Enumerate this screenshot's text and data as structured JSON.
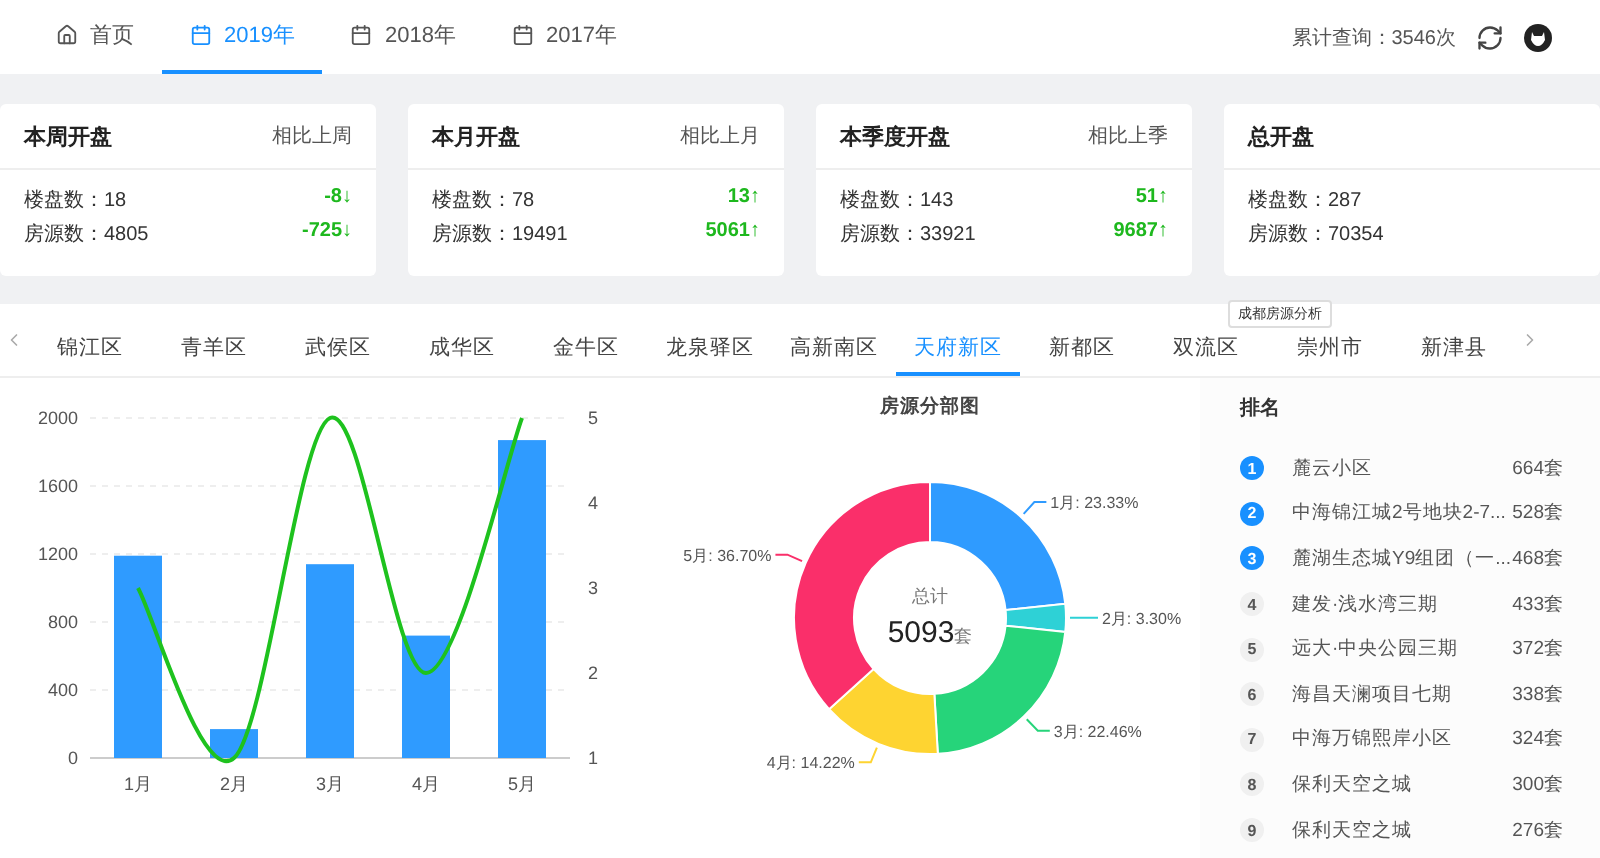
{
  "nav": {
    "items": [
      {
        "label": "首页",
        "selected": false
      },
      {
        "label": "2019年",
        "selected": true
      },
      {
        "label": "2018年",
        "selected": false
      },
      {
        "label": "2017年",
        "selected": false
      }
    ],
    "query_count": "累计查询：3546次"
  },
  "cards": [
    {
      "title": "本周开盘",
      "compare": "相比上周",
      "rows": [
        {
          "label": "楼盘数：18",
          "delta": "-8↓"
        },
        {
          "label": "房源数：4805",
          "delta": "-725↓"
        }
      ]
    },
    {
      "title": "本月开盘",
      "compare": "相比上月",
      "rows": [
        {
          "label": "楼盘数：78",
          "delta": "13↑"
        },
        {
          "label": "房源数：19491",
          "delta": "5061↑"
        }
      ]
    },
    {
      "title": "本季度开盘",
      "compare": "相比上季",
      "rows": [
        {
          "label": "楼盘数：143",
          "delta": "51↑"
        },
        {
          "label": "房源数：33921",
          "delta": "9687↑"
        }
      ]
    },
    {
      "title": "总开盘",
      "rows": [
        {
          "label": "楼盘数：287"
        },
        {
          "label": "房源数：70354"
        }
      ]
    }
  ],
  "district_tabs": [
    {
      "label": "锦江区",
      "selected": false
    },
    {
      "label": "青羊区",
      "selected": false
    },
    {
      "label": "武侯区",
      "selected": false
    },
    {
      "label": "成华区",
      "selected": false
    },
    {
      "label": "金牛区",
      "selected": false
    },
    {
      "label": "龙泉驿区",
      "selected": false
    },
    {
      "label": "高新南区",
      "selected": false
    },
    {
      "label": "天府新区",
      "selected": true
    },
    {
      "label": "新都区",
      "selected": false
    },
    {
      "label": "双流区",
      "selected": false
    },
    {
      "label": "崇州市",
      "selected": false
    },
    {
      "label": "新津县",
      "selected": false
    }
  ],
  "tooltip": "成都房源分析",
  "bar_chart": {
    "chart_data": {
      "type": "bar",
      "categories": [
        "1月",
        "2月",
        "3月",
        "4月",
        "5月"
      ],
      "grid": true,
      "series": [
        {
          "color": "#2f9bff",
          "values": [
            1190,
            170,
            1140,
            720,
            1870
          ]
        }
      ],
      "ylim": [
        0,
        2000
      ],
      "yticks": [
        0,
        400,
        800,
        1200,
        1600,
        2000
      ]
    }
  },
  "line_chart": {
    "chart_data": {
      "type": "line",
      "series": [
        {
          "color": "#1ec21e",
          "values": [
            3,
            1,
            5,
            2,
            5
          ]
        }
      ],
      "ylim": [
        1,
        5
      ],
      "yticks": [
        1,
        2,
        3,
        4,
        5
      ]
    }
  },
  "donut_chart": {
    "chart_data": {
      "type": "donut",
      "title": "房源分部图",
      "series": [
        {
          "colors": [
            "#2f9bff",
            "#2ed1d6",
            "#26d47a",
            "#fed431",
            "#fa2f6a"
          ],
          "values": [
            23.33,
            3.3,
            22.46,
            14.22,
            36.7
          ]
        }
      ],
      "value_labels": [
        "1月: 23.33%",
        "2月: 3.30%",
        "3月: 22.46%",
        "4月: 14.22%",
        "5月: 36.70%"
      ]
    },
    "center_label": "总计",
    "center_value": "5093",
    "center_unit": "套"
  },
  "ranking": {
    "title": "排名",
    "items": [
      {
        "rank": "1",
        "top": true,
        "name": "麓云小区",
        "count": "664套"
      },
      {
        "rank": "2",
        "top": true,
        "name": "中海锦江城2号地块2-7...",
        "count": "528套"
      },
      {
        "rank": "3",
        "top": true,
        "name": "麓湖生态城Y9组团（一...",
        "count": "468套"
      },
      {
        "rank": "4",
        "top": false,
        "name": "建发·浅水湾三期",
        "count": "433套"
      },
      {
        "rank": "5",
        "top": false,
        "name": "远大·中央公园三期",
        "count": "372套"
      },
      {
        "rank": "6",
        "top": false,
        "name": "海昌天澜项目七期",
        "count": "338套"
      },
      {
        "rank": "7",
        "top": false,
        "name": "中海万锦熙岸小区",
        "count": "324套"
      },
      {
        "rank": "8",
        "top": false,
        "name": "保利天空之城",
        "count": "300套"
      },
      {
        "rank": "9",
        "top": false,
        "name": "保利天空之城",
        "count": "276套"
      }
    ]
  }
}
